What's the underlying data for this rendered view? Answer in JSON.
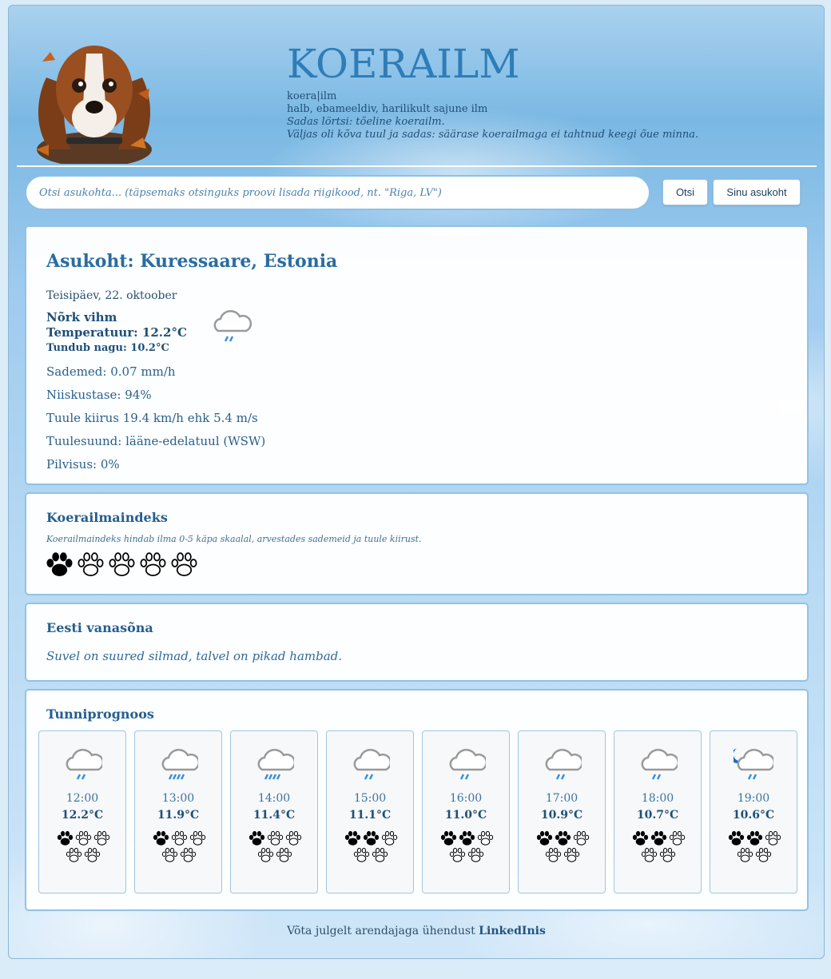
{
  "header": {
    "title": "KOERAILM",
    "dict_word": "koera|ilm",
    "dict_def": "halb, ebameeldiv, harilikult sajune ilm",
    "dict_ex1": "Sadas lörtsi: tõeline koerailm.",
    "dict_ex2": "Väljas oli kõva tuul ja sadas: säärase koerailmaga ei tahtnud keegi õue minna."
  },
  "search": {
    "placeholder": "Otsi asukohta... (täpsemaks otsinguks proovi lisada riigikood, nt. \"Riga, LV\")",
    "search_label": "Otsi",
    "location_label": "Sinu asukoht"
  },
  "current": {
    "location": "Asukoht: Kuressaare, Estonia",
    "date": "Teisipäev, 22. oktoober",
    "condition": "Nõrk vihm",
    "temperature": "Temperatuur: 12.2°C",
    "feels_like": "Tundub nagu: 10.2°C",
    "precipitation": "Sademed: 0.07 mm/h",
    "humidity": "Niiskustase: 94%",
    "wind_speed": "Tuule kiirus 19.4 km/h ehk 5.4 m/s",
    "wind_dir": "Tuulesuund: lääne-edelatuul (WSW)",
    "cloud": "Pilvisus: 0%",
    "icon": "light-rain-icon"
  },
  "index": {
    "heading": "Koerailmaindeks",
    "note": "Koerailmaindeks hindab ilma 0-5 käpa skaalal, arvestades sademeid ja tuule kiirust.",
    "score": 1,
    "max": 5
  },
  "proverb": {
    "heading": "Eesti vanasõna",
    "text": "Suvel on suured silmad, talvel on pikad hambad."
  },
  "hourly": {
    "heading": "Tunniprognoos",
    "items": [
      {
        "time": "12:00",
        "temp": "12.2°C",
        "score": 1,
        "icon": "light-rain-icon"
      },
      {
        "time": "13:00",
        "temp": "11.9°C",
        "score": 1,
        "icon": "moderate-rain-icon"
      },
      {
        "time": "14:00",
        "temp": "11.4°C",
        "score": 1,
        "icon": "moderate-rain-icon"
      },
      {
        "time": "15:00",
        "temp": "11.1°C",
        "score": 2,
        "icon": "light-rain-icon"
      },
      {
        "time": "16:00",
        "temp": "11.0°C",
        "score": 2,
        "icon": "light-rain-icon"
      },
      {
        "time": "17:00",
        "temp": "10.9°C",
        "score": 2,
        "icon": "light-rain-icon"
      },
      {
        "time": "18:00",
        "temp": "10.7°C",
        "score": 2,
        "icon": "light-rain-icon"
      },
      {
        "time": "19:00",
        "temp": "10.6°C",
        "score": 2,
        "icon": "night-light-rain-icon"
      }
    ]
  },
  "footer": {
    "text": "Võta julgelt arendajaga ühendust ",
    "link": "LinkedInis"
  },
  "colors": {
    "accent": "#2e7db8",
    "card_border": "#92c2e4",
    "rain": "#3a8fd6",
    "moon": "#1a6fc4"
  }
}
